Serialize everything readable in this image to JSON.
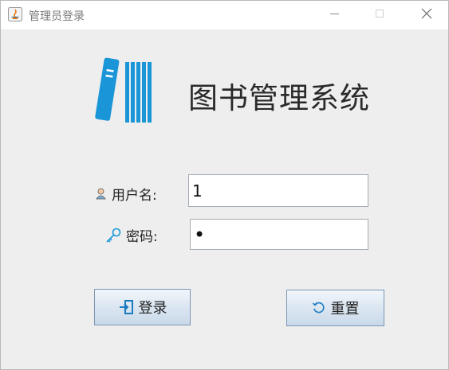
{
  "window": {
    "title": "管理员登录"
  },
  "header": {
    "app_title": "图书管理系统",
    "logo_icon": "books-icon",
    "accent": "#1a96d8"
  },
  "form": {
    "username_label": "用户名:",
    "username_value": "1",
    "password_label": "密码:",
    "password_value": "•"
  },
  "buttons": {
    "login_label": "登录",
    "reset_label": "重置"
  }
}
